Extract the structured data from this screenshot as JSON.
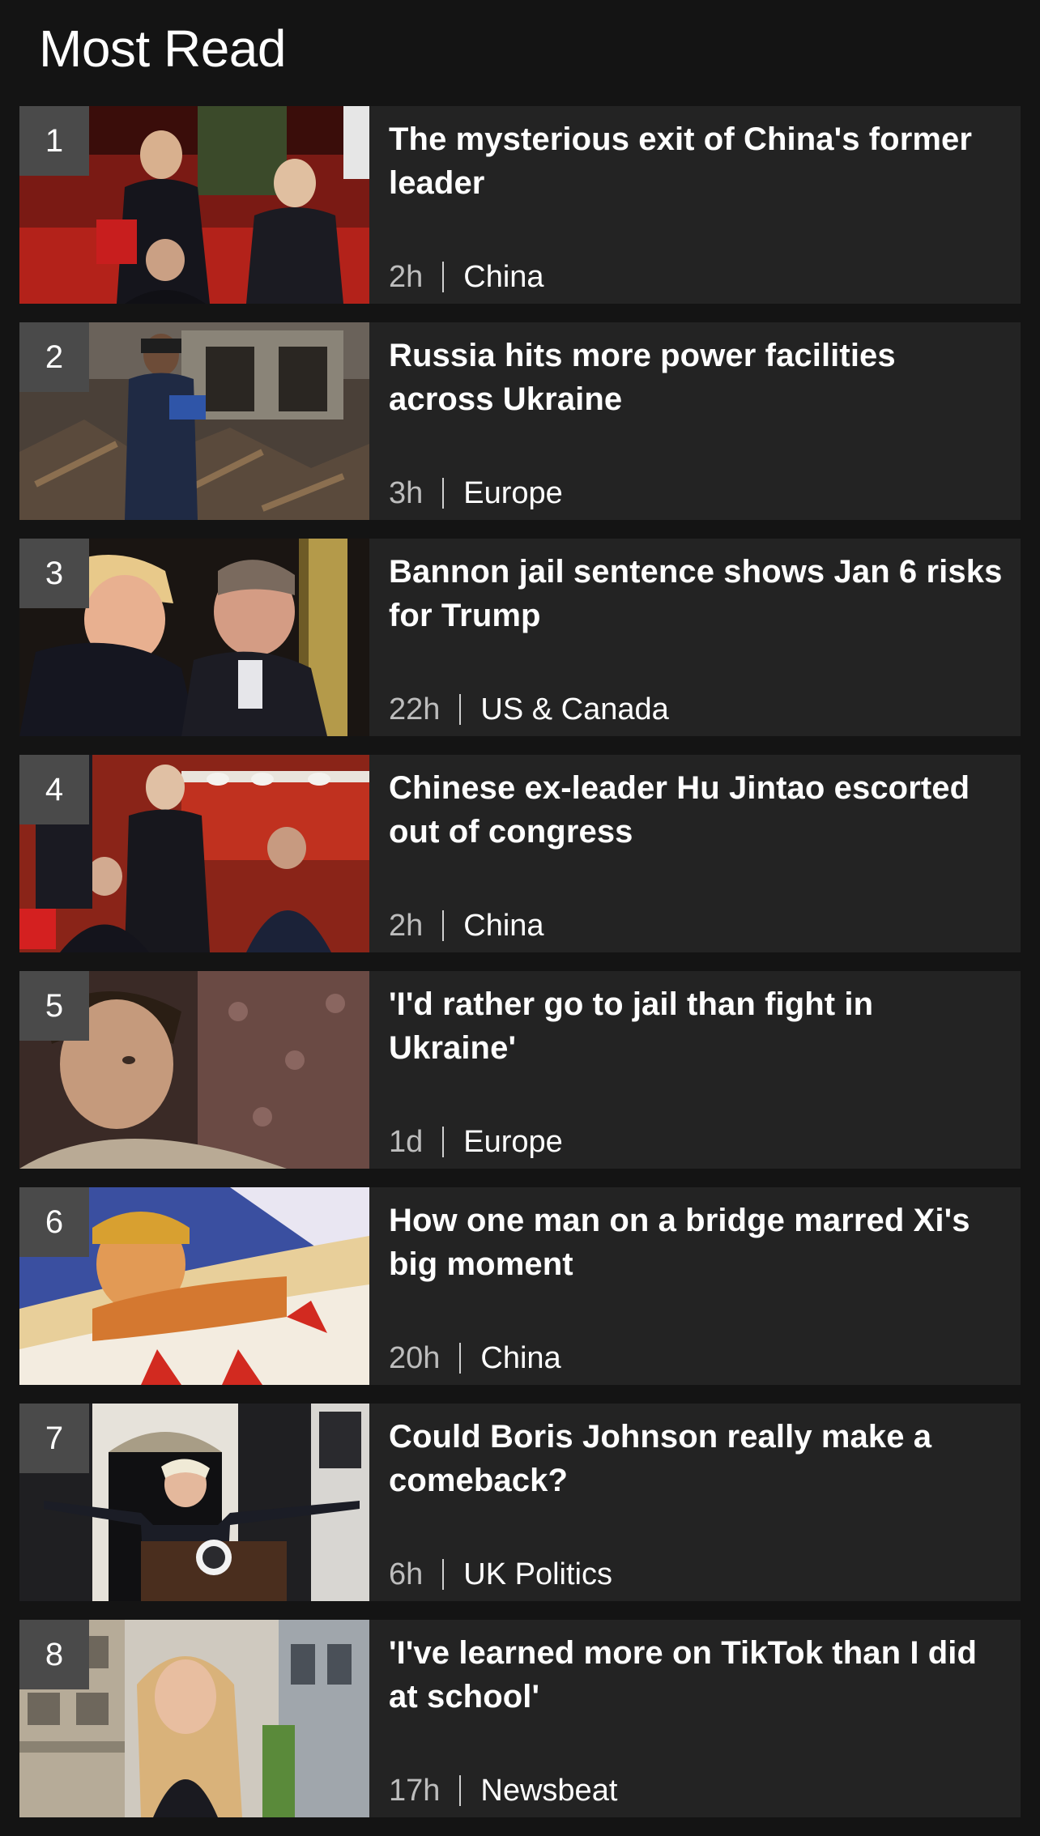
{
  "section": {
    "title": "Most Read"
  },
  "items": [
    {
      "rank": "1",
      "headline": "The mysterious exit of China's former leader",
      "age": "2h",
      "topic": "China",
      "image": "photo-officials-at-congress"
    },
    {
      "rank": "2",
      "headline": "Russia hits more power facilities across Ukraine",
      "age": "3h",
      "topic": "Europe",
      "image": "photo-damaged-building"
    },
    {
      "rank": "3",
      "headline": "Bannon jail sentence shows Jan 6 risks for Trump",
      "age": "22h",
      "topic": "US & Canada",
      "image": "photo-two-men-embracing"
    },
    {
      "rank": "4",
      "headline": "Chinese ex-leader Hu Jintao escorted out of congress",
      "age": "2h",
      "topic": "China",
      "image": "photo-leaders-at-table"
    },
    {
      "rank": "5",
      "headline": "'I'd rather go to jail than fight in Ukraine'",
      "age": "1d",
      "topic": "Europe",
      "image": "photo-young-man-portrait"
    },
    {
      "rank": "6",
      "headline": "How one man on a bridge marred Xi's big moment",
      "age": "20h",
      "topic": "China",
      "image": "photo-propaganda-poster"
    },
    {
      "rank": "7",
      "headline": "Could Boris Johnson really make a comeback?",
      "age": "6h",
      "topic": "UK Politics",
      "image": "photo-speaker-at-lectern"
    },
    {
      "rank": "8",
      "headline": "'I've learned more on TikTok than I did at school'",
      "age": "17h",
      "topic": "Newsbeat",
      "image": "photo-woman-on-balcony"
    }
  ],
  "colors": {
    "page_background": "#141414",
    "card_background": "#232323",
    "rank_badge": "#4a4a4a",
    "headline_text": "#ffffff",
    "age_text": "#bdbdbd"
  }
}
